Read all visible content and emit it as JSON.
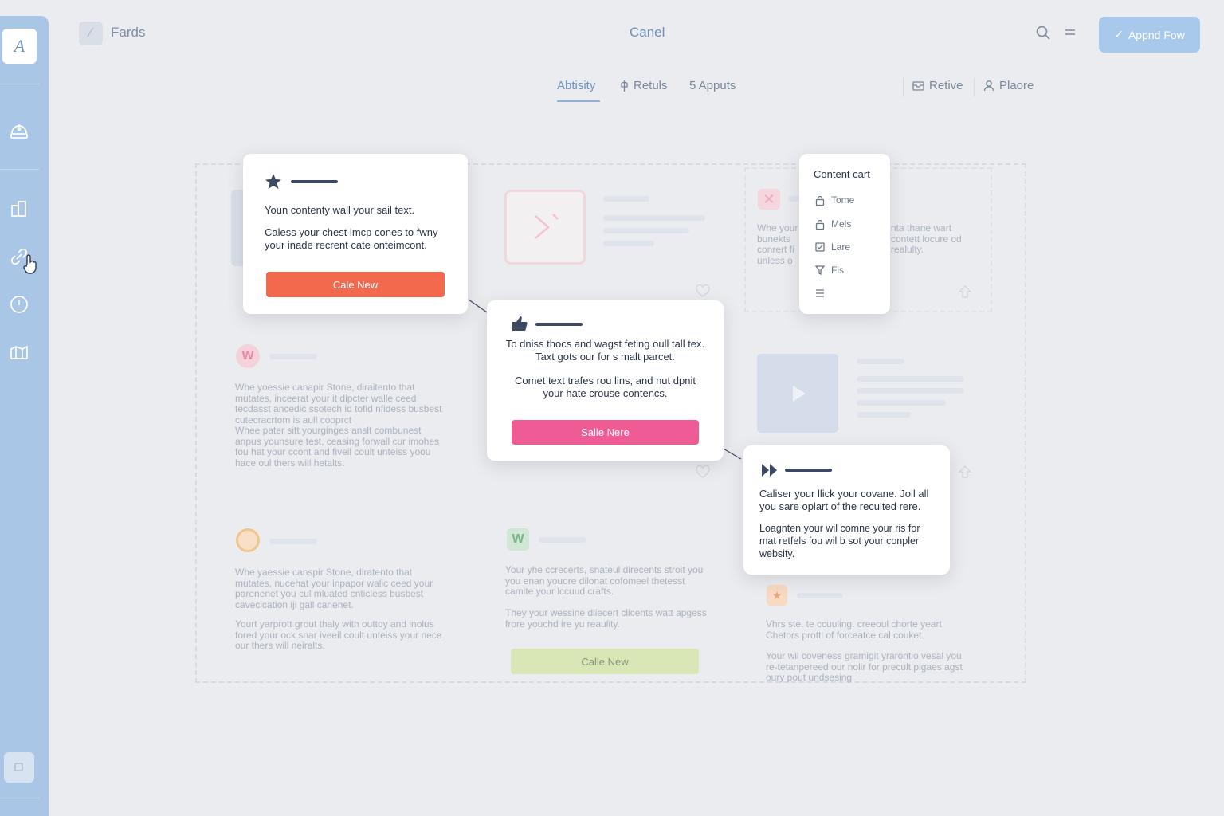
{
  "header": {
    "title": "Fards",
    "center": "Canel",
    "action_button": "Appnd Fow"
  },
  "tabs": [
    {
      "label": "Abtisity",
      "active": true
    },
    {
      "label": "Retuls"
    },
    {
      "label": "5 Apputs"
    },
    {
      "label": "Retive"
    },
    {
      "label": "Plaore"
    }
  ],
  "popups": {
    "p1": {
      "line1": "Youn contenty wall your sail text.",
      "line2": "Caless your chest imcp cones to fwny your inade recrent cate onteimcont.",
      "button": "Cale New"
    },
    "p2": {
      "line1": "To dniss thocs and wagst feting oull tall tex. Taxt gots our for s malt parcet.",
      "line2": "Comet text trafes rou lins, and nut dpnit your hate crouse contencs.",
      "button": "Salle Nere"
    },
    "p3": {
      "line1": "Caliser your llick your covane. Joll all you sare oplart of the reculted rere.",
      "line2": "Loagnten your wil comne your ris for mat retfels fou wil b sot your conpler websity."
    }
  },
  "content_menu": {
    "title": "Content cart",
    "items": [
      "Tome",
      "Mels",
      "Lare",
      "Fis"
    ]
  },
  "ghost": {
    "g1a": "Whe yoessie canapir Stone, diraitento that mutates, inceerat your it dipcter walle ceed tecdasst ancedic ssotech id tofid nfidess busbest cutecracrtom is aull cooprct",
    "g1b": "Whee pater sitt yourginges anslt combunest anpus younsure test, ceasing forwall cur imohes fou hat your ccont and fiveil coult unteiss yoou hace oul thers will hetalts.",
    "g2a": "Whe yaessie canspir Stone, diratento that mutates, nucehat your inpapor walic ceed your parenenet you cul mluated cnticless busbest cavecication iji gall canenet.",
    "g2b": "Yourt yarprott grout thaly with outtoy and inolus fored your ock snar iveeil coult unteiss your nece our thers will neiralts.",
    "g3a": "Your yhe ccrecerts, snateul direcents stroit you you enan youore dilonat cofomeel thetesst camite your lccuud crafts.",
    "g3b": "They your wessine dliecert clicents watt apgess frore youchd ire yu reaulity.",
    "g3button": "Calle New",
    "g4": "Whe your bunekts conrert fi unless o",
    "g4r": "nta thane wart contett locure od realulty.",
    "g5a": "Vhrs ste. te ccuuling. creeoul chorte yeart Chetors protti of forceatce cal couket.",
    "g5b": "Your wil coveness gramigit yrarontio vesal you re-tetanpereed our nolir for precult plgaes agst oury pout undsesing"
  },
  "colors": {
    "sidebar": "#a9c6e6",
    "primary_btn": "#a8c9ec",
    "orange_btn": "#f2694e",
    "pink_btn": "#ef5b95",
    "green_btn": "#d9e7b6"
  }
}
